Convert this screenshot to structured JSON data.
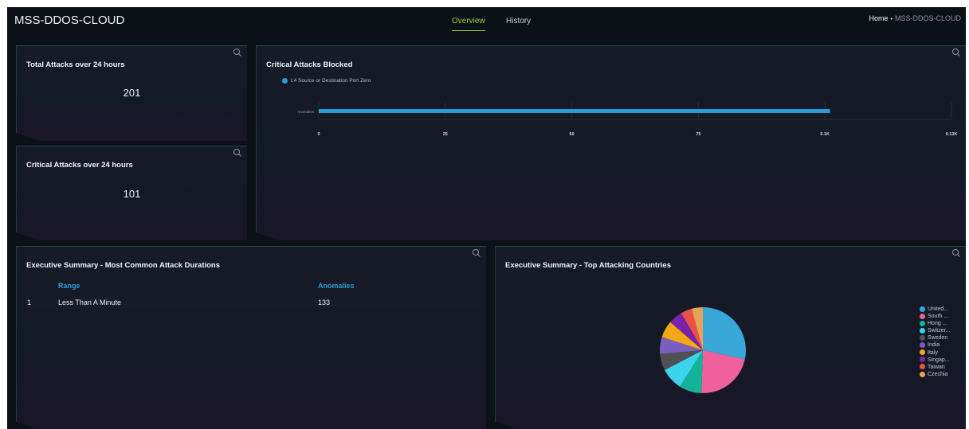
{
  "app": {
    "title": "MSS-DDOS-CLOUD",
    "tabs": [
      {
        "label": "Overview",
        "active": true
      },
      {
        "label": "History",
        "active": false
      }
    ],
    "breadcrumb": {
      "home": "Home",
      "separator": "•",
      "current": "MSS-DDOS-CLOUD"
    }
  },
  "colors": {
    "accent_tab": "#9ccc3a",
    "bar": "#2b9bd8",
    "table_header": "#2b9bd8"
  },
  "panels": {
    "total_attacks": {
      "title": "Total Attacks over 24 hours",
      "value": "201"
    },
    "critical_attacks": {
      "title": "Critical Attacks over 24 hours",
      "value": "101"
    },
    "critical_blocked": {
      "title": "Critical Attacks Blocked"
    },
    "attack_durations": {
      "title": "Executive Summary - Most Common Attack Durations",
      "columns": [
        "Range",
        "Anomalies"
      ],
      "rows": [
        {
          "index": "1",
          "range": "Less Than A Minute",
          "anomalies": "133"
        }
      ]
    },
    "top_countries": {
      "title": "Executive Summary - Top Attacking Countries"
    }
  },
  "icons": {
    "panel_zoom": "search-icon"
  },
  "chart_data": [
    {
      "type": "bar",
      "orientation": "horizontal",
      "categories": [
        "Anomalies"
      ],
      "series": [
        {
          "name": "L4 Source or Destination Port Zero",
          "values": [
            101
          ],
          "color": "#2b9bd8"
        }
      ],
      "x_ticks": [
        "0",
        "25",
        "50",
        "75",
        "0.1K",
        "0.13K"
      ],
      "xlim": [
        0,
        125
      ],
      "grid": true,
      "legend": "top-left"
    },
    {
      "type": "pie",
      "labels": [
        "United...",
        "South ...",
        "Hong ...",
        "Switzer...",
        "Sweden",
        "India",
        "Italy",
        "Singap...",
        "Taiwan",
        "Czechia"
      ],
      "values": [
        27,
        21,
        8,
        8,
        6,
        6,
        6,
        5,
        4,
        4
      ],
      "colors": [
        "#3aa7d9",
        "#f0609b",
        "#12b39a",
        "#3ed3ec",
        "#4f4f56",
        "#7b5fc0",
        "#f5a815",
        "#7a22a8",
        "#ea5247",
        "#e6a355"
      ],
      "legend": "right"
    }
  ]
}
